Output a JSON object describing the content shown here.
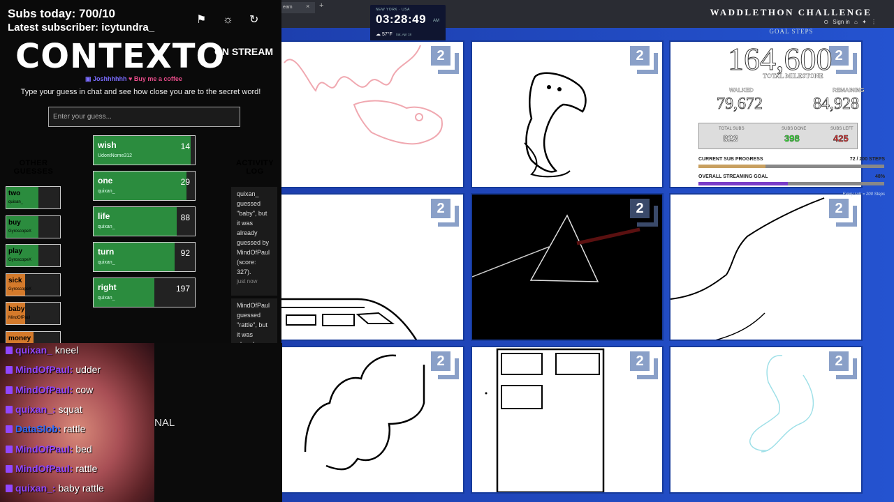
{
  "colors": {
    "accent_green": "#2b8c3e",
    "accent_orange": "#d47a2b",
    "twitch_purple": "#9146ff",
    "stage_blue": "#1f45b8"
  },
  "header": {
    "subs_today": "Subs today: 700/10",
    "latest_subscriber": "Latest subscriber: icytundra_",
    "icons": [
      "flag-icon",
      "lightbulb-icon",
      "refresh-icon"
    ]
  },
  "contexto": {
    "title": "CONTEXTO",
    "subtitle": "ON STREAM",
    "credit_author": "Joshhhhhh",
    "credit_coffee": "Buy me a coffee",
    "instructions": "Type your guess in chat and see how close you are to the secret word!",
    "input_placeholder": "Enter your guess...",
    "guesses": [
      {
        "word": "wish",
        "user": "UdontNome312",
        "rank": "14",
        "fill": 0.96
      },
      {
        "word": "one",
        "user": "quixan_",
        "rank": "29",
        "fill": 0.92
      },
      {
        "word": "life",
        "user": "quixan_",
        "rank": "88",
        "fill": 0.82
      },
      {
        "word": "turn",
        "user": "quixan_",
        "rank": "92",
        "fill": 0.8
      },
      {
        "word": "right",
        "user": "quixan_",
        "rank": "197",
        "fill": 0.6
      }
    ],
    "other_title": "OTHER GUESSES",
    "other_guesses": [
      {
        "word": "two",
        "user": "quixan_",
        "fill": 0.6,
        "color": "#2b8c3e"
      },
      {
        "word": "buy",
        "user": "GyroscopeX",
        "fill": 0.6,
        "color": "#2b8c3e"
      },
      {
        "word": "play",
        "user": "GyroscopeX",
        "fill": 0.6,
        "color": "#2b8c3e"
      },
      {
        "word": "sick",
        "user": "GyroscopeX",
        "fill": 0.35,
        "color": "#d47a2b"
      },
      {
        "word": "baby",
        "user": "MindOfPaul",
        "fill": 0.35,
        "color": "#d47a2b"
      },
      {
        "word": "money",
        "user": "",
        "fill": 0.5,
        "color": "#d47a2b"
      }
    ],
    "activity_title": "ACTIVITY LOG",
    "activity": [
      {
        "text": "quixan_ guessed \"baby\", but it was already guessed by MindOfPaul (score: 327).",
        "time": "just now"
      },
      {
        "text": "MindOfPaul guessed \"rattle\", but it was already",
        "time": ""
      }
    ]
  },
  "chat": {
    "messages": [
      {
        "user": "quixan_",
        "text": "kneel",
        "color": "#9146ff"
      },
      {
        "user": "MindOfPaul:",
        "text": "udder",
        "color": "#9146ff"
      },
      {
        "user": "MindOfPaul:",
        "text": "cow",
        "color": "#9146ff"
      },
      {
        "user": "quixan_:",
        "text": "squat",
        "color": "#9146ff"
      },
      {
        "user": "DataSlob:",
        "text": "rattle",
        "color": "#2f6bff"
      },
      {
        "user": "MindOfPaul:",
        "text": "bed",
        "color": "#9146ff"
      },
      {
        "user": "MindOfPaul:",
        "text": "rattle",
        "color": "#9146ff"
      },
      {
        "user": "quixan_:",
        "text": "baby rattle",
        "color": "#9146ff"
      }
    ],
    "partial_text": "NAL"
  },
  "browser": {
    "tab_label": "eam",
    "tab_close": "×",
    "new_tab": "+",
    "sign_in": "Sign in"
  },
  "clock": {
    "city": "NEW YORK · USA",
    "time": "03:28:49",
    "ampm": "AM",
    "temp": "57°F",
    "date": "Sat, Apr 18"
  },
  "challenge": {
    "title": "WADDLETHON CHALLENGE",
    "goal_steps": "GOAL STEPS",
    "total_milestone": "164,600",
    "total_milestone_label": "TOTAL MILESTONE",
    "walked_label": "WALKED",
    "walked": "79,672",
    "remaining_label": "REMAINING",
    "remaining": "84,928",
    "total_subs_label": "TOTAL SUBS",
    "total_subs": "823",
    "subs_done_label": "SUBS DONE",
    "subs_done": "398",
    "subs_left_label": "SUBS LEFT",
    "subs_left": "425",
    "current_progress_label": "CURRENT SUB PROGRESS",
    "current_progress_value": "72 / 200 STEPS",
    "current_progress": 0.36,
    "overall_label": "OVERALL STREAMING GOAL",
    "overall_value": "48%",
    "overall_progress": 0.48,
    "footnote": "Every sub = 200 Steps"
  },
  "drawings": {
    "badge_number": "2"
  }
}
